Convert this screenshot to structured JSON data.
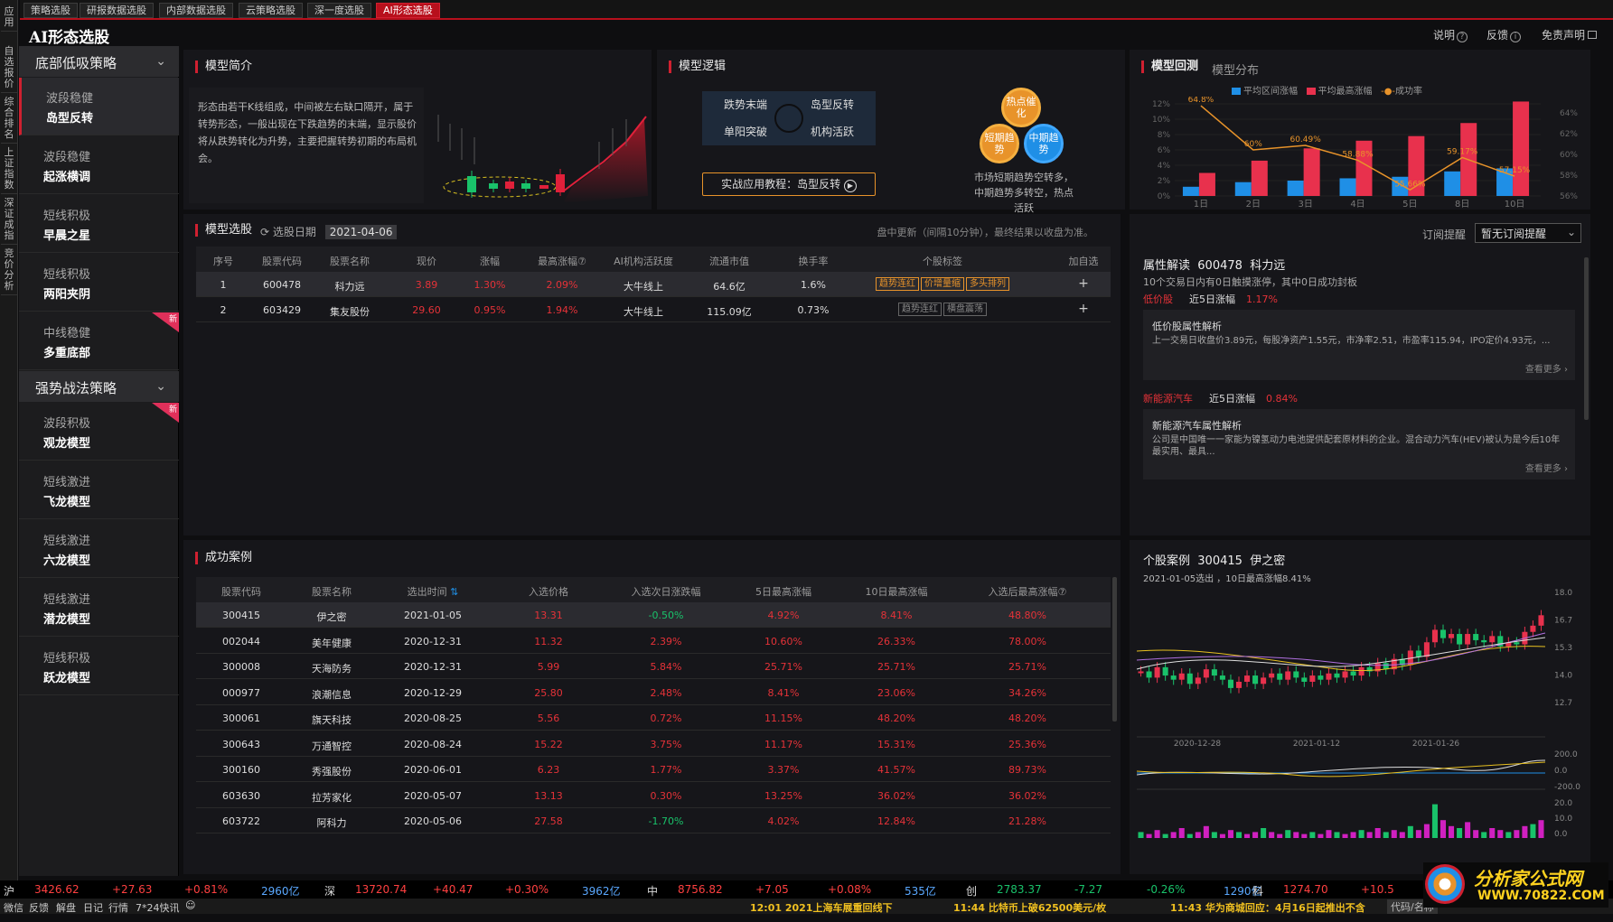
{
  "top_tabs": [
    "策略选股",
    "研报数据选股",
    "内部数据选股",
    "云策略选股",
    "深一度选股",
    "AI形态选股"
  ],
  "left_rail": [
    "应用",
    "自选报价",
    "综合排名",
    "上证指数",
    "深证成指",
    "竞价分析"
  ],
  "app_title": "AI形态选股",
  "header_links": {
    "help": "说明",
    "feedback": "反馈",
    "disclaimer": "免责声明"
  },
  "sidebar": {
    "section1": "底部低吸策略",
    "items1": [
      {
        "l1": "波段稳健",
        "l2": "岛型反转"
      },
      {
        "l1": "波段稳健",
        "l2": "起涨横调"
      },
      {
        "l1": "短线积极",
        "l2": "早晨之星"
      },
      {
        "l1": "短线积极",
        "l2": "两阳夹阴"
      },
      {
        "l1": "中线稳健",
        "l2": "多重底部",
        "badge": "新"
      }
    ],
    "section2": "强势战法策略",
    "items2": [
      {
        "l1": "波段积极",
        "l2": "观龙模型",
        "badge": "新"
      },
      {
        "l1": "短线激进",
        "l2": "飞龙模型"
      },
      {
        "l1": "短线激进",
        "l2": "六龙模型"
      },
      {
        "l1": "短线激进",
        "l2": "潜龙模型"
      },
      {
        "l1": "短线积极",
        "l2": "跃龙模型"
      }
    ]
  },
  "model_intro": {
    "title": "模型简介",
    "text": "形态由若干K线组成，中间被左右缺口隔开，属于转势形态，一般出现在下跌趋势的末端，显示股价将从跌势转化为升势，主要把握转势初期的布局机会。"
  },
  "model_logic": {
    "title": "模型逻辑",
    "cells": [
      "跌势末端",
      "岛型反转",
      "单阳突破",
      "机构活跃"
    ],
    "button": "实战应用教程：岛型反转",
    "bubbles": [
      "热点催化",
      "短期趋势",
      "中期趋势"
    ],
    "caption": "市场短期趋势空转多，中期趋势多转空，热点活跃"
  },
  "backtest": {
    "tab_active": "模型回测",
    "tab_other": "模型分布",
    "legend": [
      "平均区间涨幅",
      "平均最高涨幅",
      "成功率"
    ],
    "y_left_ticks": [
      "12%",
      "10%",
      "8%",
      "6%",
      "4%",
      "2%",
      "0%"
    ],
    "y_right_ticks": [
      "64%",
      "62%",
      "60%",
      "58%",
      "56%"
    ]
  },
  "chart_data": [
    {
      "type": "bar",
      "title": "模型回测",
      "categories": [
        "1日",
        "2日",
        "3日",
        "4日",
        "5日",
        "8日",
        "10日"
      ],
      "series": [
        {
          "name": "平均区间涨幅",
          "values": [
            1.2,
            1.8,
            2.0,
            2.3,
            2.5,
            3.2,
            3.6
          ],
          "color": "#1f8fe6"
        },
        {
          "name": "平均最高涨幅",
          "values": [
            3.0,
            4.6,
            6.2,
            7.2,
            7.8,
            9.5,
            12.3
          ],
          "color": "#e8314d"
        },
        {
          "name": "成功率",
          "values": [
            64.8,
            60.0,
            60.49,
            58.88,
            55.66,
            59.17,
            57.15
          ],
          "color": "#e8932a"
        }
      ],
      "ylim": [
        0,
        12
      ],
      "y2lim": [
        55,
        65
      ]
    },
    {
      "type": "candlestick",
      "title": "个股案例 300415 伊之密",
      "x_labels": [
        "2020-12-28",
        "2021-01-12",
        "2021-01-26"
      ],
      "y_ticks": [
        "18.0",
        "16.7",
        "15.3",
        "14.0",
        "12.7"
      ],
      "macd_ticks": [
        "200.0",
        "0.0",
        "-200.0"
      ],
      "vol_ticks": [
        "20.0",
        "10.0",
        "0.0"
      ]
    }
  ],
  "selection": {
    "title": "模型选股",
    "date_label": "选股日期",
    "date": "2021-04-06",
    "note": "盘中更新（间隔10分钟），最终结果以收盘为准。",
    "headers": [
      "序号",
      "股票代码",
      "股票名称",
      "现价",
      "涨幅",
      "最高涨幅⑦",
      "AI机构活跃度",
      "流通市值",
      "换手率",
      "个股标签",
      "加自选"
    ],
    "rows": [
      {
        "no": "1",
        "code": "600478",
        "name": "科力远",
        "price": "3.89",
        "chg": "1.30%",
        "maxchg": "2.09%",
        "ai": "大牛线上",
        "mcap": "64.6亿",
        "turn": "1.6%",
        "tags": [
          "趋势连红",
          "价增量缩",
          "多头排列"
        ],
        "tag_on": [
          true,
          true,
          true
        ]
      },
      {
        "no": "2",
        "code": "603429",
        "name": "集友股份",
        "price": "29.60",
        "chg": "0.95%",
        "maxchg": "1.94%",
        "ai": "大牛线上",
        "mcap": "115.09亿",
        "turn": "0.73%",
        "tags": [
          "趋势连红",
          "横盘震荡"
        ],
        "tag_on": [
          false,
          false
        ]
      }
    ]
  },
  "subscribe": {
    "label": "订阅提醒",
    "value": "暂无订阅提醒"
  },
  "attr": {
    "title": "属性解读",
    "code": "600478",
    "name": "科力远",
    "sub": "10个交易日内有0日触摸涨停，其中0日成功封板",
    "blocks": [
      {
        "tag": "低价股",
        "chg_label": "近5日涨幅",
        "chg": "1.17%",
        "card_title": "低价股属性解析",
        "card_text": "上一交易日收盘价3.89元，每股净资产1.55元，市净率2.51，市盈率115.94，IPO定价4.93元，...",
        "more": "查看更多 ›"
      },
      {
        "tag": "新能源汽车",
        "chg_label": "近5日涨幅",
        "chg": "0.84%",
        "card_title": "新能源汽车属性解析",
        "card_text": "公司是中国唯一一家能为镍氢动力电池提供配套原材料的企业。混合动力汽车(HEV)被认为是今后10年最实用、最具...",
        "more": "查看更多 ›"
      }
    ]
  },
  "cases": {
    "title": "成功案例",
    "headers": [
      "股票代码",
      "股票名称",
      "选出时间",
      "入选价格",
      "入选次日涨跌幅",
      "5日最高涨幅",
      "10日最高涨幅",
      "入选后最高涨幅⑦"
    ],
    "rows": [
      {
        "code": "300415",
        "name": "伊之密",
        "date": "2021-01-05",
        "price": "13.31",
        "d1": "-0.50%",
        "d5": "4.92%",
        "d10": "8.41%",
        "dmax": "48.80%"
      },
      {
        "code": "002044",
        "name": "美年健康",
        "date": "2020-12-31",
        "price": "11.32",
        "d1": "2.39%",
        "d5": "10.60%",
        "d10": "26.33%",
        "dmax": "78.00%"
      },
      {
        "code": "300008",
        "name": "天海防务",
        "date": "2020-12-31",
        "price": "5.99",
        "d1": "5.84%",
        "d5": "25.71%",
        "d10": "25.71%",
        "dmax": "25.71%"
      },
      {
        "code": "000977",
        "name": "浪潮信息",
        "date": "2020-12-29",
        "price": "25.80",
        "d1": "2.48%",
        "d5": "8.41%",
        "d10": "23.06%",
        "dmax": "34.26%"
      },
      {
        "code": "300061",
        "name": "旗天科技",
        "date": "2020-08-25",
        "price": "5.56",
        "d1": "0.72%",
        "d5": "11.15%",
        "d10": "48.20%",
        "dmax": "48.20%"
      },
      {
        "code": "300643",
        "name": "万通智控",
        "date": "2020-08-24",
        "price": "15.22",
        "d1": "3.75%",
        "d5": "11.17%",
        "d10": "15.31%",
        "dmax": "25.36%"
      },
      {
        "code": "300160",
        "name": "秀强股份",
        "date": "2020-06-01",
        "price": "6.23",
        "d1": "1.77%",
        "d5": "3.37%",
        "d10": "41.57%",
        "dmax": "89.73%"
      },
      {
        "code": "603630",
        "name": "拉芳家化",
        "date": "2020-05-07",
        "price": "13.13",
        "d1": "0.30%",
        "d5": "13.25%",
        "d10": "36.02%",
        "dmax": "36.02%"
      },
      {
        "code": "603722",
        "name": "阿科力",
        "date": "2020-05-06",
        "price": "27.58",
        "d1": "-1.70%",
        "d5": "4.02%",
        "d10": "12.84%",
        "dmax": "21.28%"
      }
    ]
  },
  "case_chart": {
    "title": "个股案例",
    "code": "300415",
    "name": "伊之密",
    "sub": "2021-01-05选出 ，10日最高涨幅8.41%"
  },
  "status": [
    {
      "mkt": "沪",
      "val": "3426.62",
      "chg": "+27.63",
      "pct": "+0.81%",
      "amt": "2960亿"
    },
    {
      "mkt": "深",
      "val": "13720.74",
      "chg": "+40.47",
      "pct": "+0.30%",
      "amt": "3962亿"
    },
    {
      "mkt": "中",
      "val": "8756.82",
      "chg": "+7.05",
      "pct": "+0.08%",
      "amt": "535亿"
    },
    {
      "mkt": "创",
      "val": "2783.37",
      "chg": "-7.27",
      "pct": "-0.26%",
      "amt": "1290亿"
    },
    {
      "mkt": "科",
      "val": "1274.70",
      "chg": "+10.5"
    }
  ],
  "bottom": {
    "left": [
      "微信",
      "反馈",
      "解盘",
      "日记",
      "行情",
      "7*24快讯"
    ],
    "news": [
      "12:01 2021上海车展重回线下",
      "11:44 比特币上破62500美元/枚",
      "11:43 华为商城回应：4月16日起推出不含"
    ],
    "search": "代码/名称"
  },
  "watermark": {
    "cn": "分析家公式网",
    "url": "WWW.70822.COM"
  }
}
